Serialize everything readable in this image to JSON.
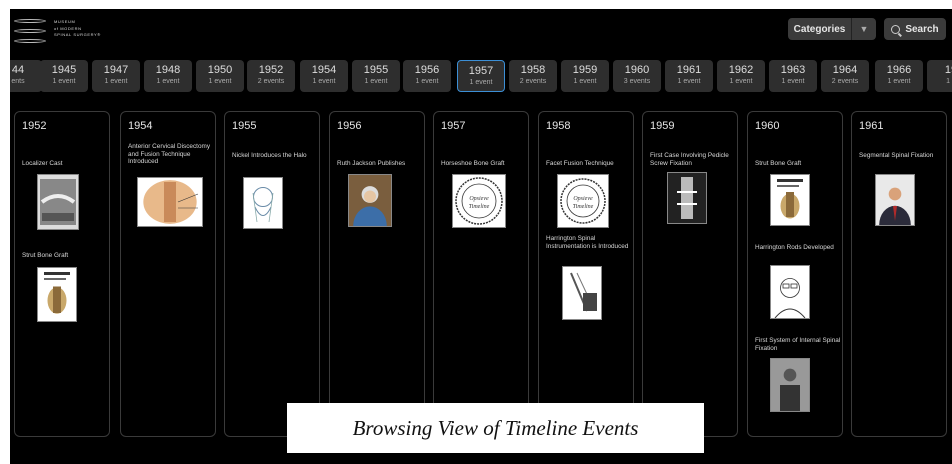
{
  "logo": {
    "lines": [
      "MUSEUM",
      "of MODERN",
      "SPINAL SURGERY®"
    ]
  },
  "header": {
    "categories_label": "Categories",
    "search_label": "Search",
    "caret_icon": "chevron-down-icon",
    "search_icon": "search-icon"
  },
  "year_strip": [
    {
      "year": "44",
      "count": "ents"
    },
    {
      "year": "1945",
      "count": "1 event"
    },
    {
      "year": "1947",
      "count": "1 event"
    },
    {
      "year": "1948",
      "count": "1 event"
    },
    {
      "year": "1950",
      "count": "1 event"
    },
    {
      "year": "1952",
      "count": "2 events"
    },
    {
      "year": "1954",
      "count": "1 event"
    },
    {
      "year": "1955",
      "count": "1 event"
    },
    {
      "year": "1956",
      "count": "1 event"
    },
    {
      "year": "1957",
      "count": "1 event",
      "active": true
    },
    {
      "year": "1958",
      "count": "2 events"
    },
    {
      "year": "1959",
      "count": "1 event"
    },
    {
      "year": "1960",
      "count": "3 events"
    },
    {
      "year": "1961",
      "count": "1 event"
    },
    {
      "year": "1962",
      "count": "1 event"
    },
    {
      "year": "1963",
      "count": "1 event"
    },
    {
      "year": "1964",
      "count": "2 events"
    },
    {
      "year": "1966",
      "count": "1 event"
    },
    {
      "year": "19",
      "count": "1 e"
    }
  ],
  "columns": [
    {
      "year": "1952",
      "events": [
        {
          "title": "Localizer Cast",
          "thumb": "xray-photo"
        },
        {
          "title": "Strut Bone Graft",
          "thumb": "document-page"
        }
      ]
    },
    {
      "year": "1954",
      "events": [
        {
          "title": "Anterior Cervical Discectomy and Fusion Technique Introduced",
          "thumb": "neck-illustration"
        }
      ]
    },
    {
      "year": "1955",
      "events": [
        {
          "title": "Nickel Introduces the Halo",
          "thumb": "halo-sketch"
        }
      ]
    },
    {
      "year": "1956",
      "events": [
        {
          "title": "Ruth Jackson Publishes",
          "thumb": "portrait"
        }
      ]
    },
    {
      "year": "1957",
      "events": [
        {
          "title": "Horseshoe Bone Graft",
          "thumb": "seal"
        }
      ]
    },
    {
      "year": "1958",
      "events": [
        {
          "title": "Facet Fusion Technique",
          "thumb": "seal"
        },
        {
          "title": "Harrington Spinal Instrumentation is Introduced",
          "thumb": "instrument-sketch"
        }
      ]
    },
    {
      "year": "1959",
      "events": [
        {
          "title": "First Case Involving Pedicle Screw Fixation",
          "thumb": "xray-spine"
        }
      ]
    },
    {
      "year": "1960",
      "events": [
        {
          "title": "Strut Bone Graft",
          "thumb": "document-page"
        },
        {
          "title": "Harrington Rods Developed",
          "thumb": "portrait-sketch"
        },
        {
          "title": "First System of Internal Spinal Fixation",
          "thumb": "bw-photo"
        }
      ]
    },
    {
      "year": "1961",
      "events": [
        {
          "title": "Segmental Spinal Fixation",
          "thumb": "portrait-color"
        }
      ]
    }
  ],
  "seal_text": [
    "Opsieve",
    "Timeline"
  ],
  "caption": "Browsing View of Timeline Events"
}
